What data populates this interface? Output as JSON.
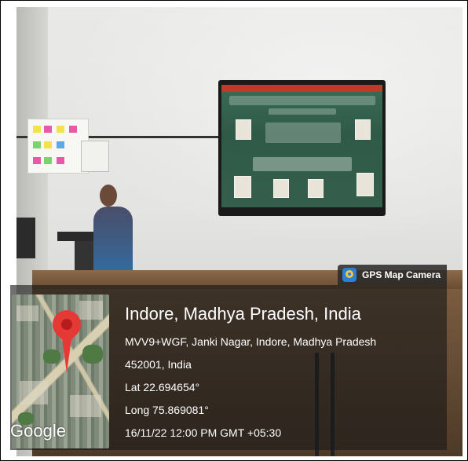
{
  "overlay": {
    "app_badge": "GPS Map Camera",
    "location_title": "Indore, Madhya Pradesh, India",
    "address_line1": "MVV9+WGF, Janki Nagar, Indore, Madhya Pradesh",
    "address_line2": "452001, India",
    "latitude": "Lat 22.694654°",
    "longitude": "Long 75.869081°",
    "datetime": "16/11/22 12:00 PM GMT +05:30",
    "map_attribution": "Google"
  },
  "colors": {
    "pin": "#e53935",
    "badge_icon": "#2d7fd3",
    "panel": "#191919"
  },
  "icons": [
    "map-pin-icon",
    "gps-map-camera-icon"
  ]
}
